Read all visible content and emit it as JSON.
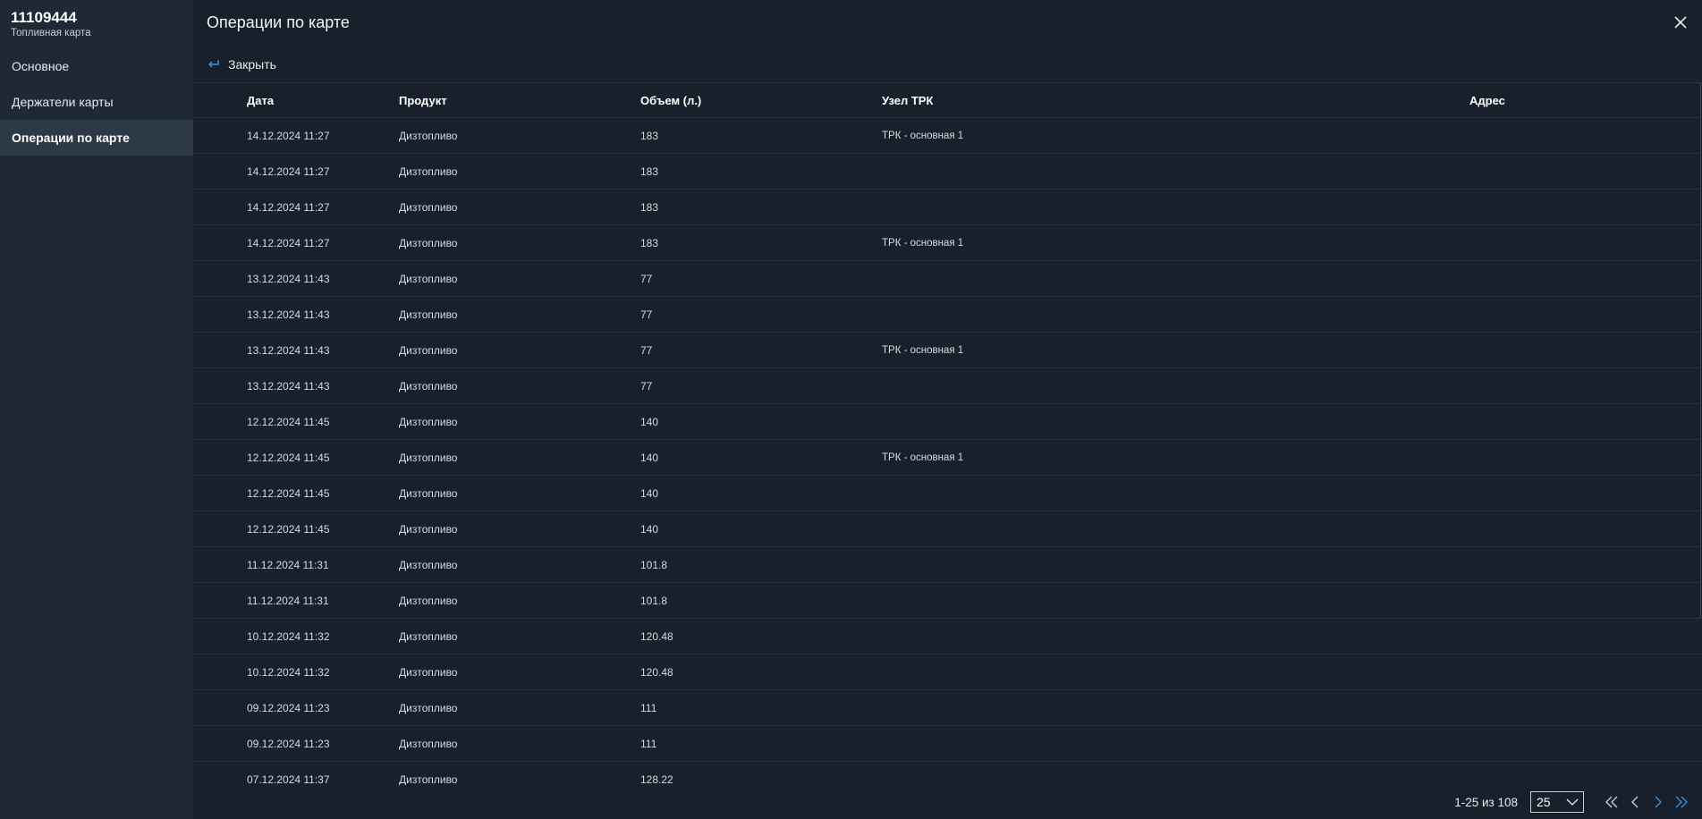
{
  "card": {
    "number": "11109444",
    "type": "Топливная карта"
  },
  "sidebar": {
    "items": [
      {
        "label": "Основное",
        "active": false
      },
      {
        "label": "Держатели карты",
        "active": false
      },
      {
        "label": "Операции по карте",
        "active": true
      }
    ]
  },
  "page": {
    "title": "Операции по карте",
    "close_label": "Закрыть"
  },
  "table": {
    "columns": [
      "Дата",
      "Продукт",
      "Объем (л.)",
      "Узел ТРК",
      "Адрес"
    ],
    "rows": [
      [
        "14.12.2024 11:27",
        "Дизтопливо",
        "183",
        "ТРК - основная 1",
        ""
      ],
      [
        "14.12.2024 11:27",
        "Дизтопливо",
        "183",
        "",
        ""
      ],
      [
        "14.12.2024 11:27",
        "Дизтопливо",
        "183",
        "",
        ""
      ],
      [
        "14.12.2024 11:27",
        "Дизтопливо",
        "183",
        "ТРК - основная 1",
        ""
      ],
      [
        "13.12.2024 11:43",
        "Дизтопливо",
        "77",
        "",
        ""
      ],
      [
        "13.12.2024 11:43",
        "Дизтопливо",
        "77",
        "",
        ""
      ],
      [
        "13.12.2024 11:43",
        "Дизтопливо",
        "77",
        "ТРК - основная 1",
        ""
      ],
      [
        "13.12.2024 11:43",
        "Дизтопливо",
        "77",
        "",
        ""
      ],
      [
        "12.12.2024 11:45",
        "Дизтопливо",
        "140",
        "",
        ""
      ],
      [
        "12.12.2024 11:45",
        "Дизтопливо",
        "140",
        "ТРК - основная 1",
        ""
      ],
      [
        "12.12.2024 11:45",
        "Дизтопливо",
        "140",
        "",
        ""
      ],
      [
        "12.12.2024 11:45",
        "Дизтопливо",
        "140",
        "",
        ""
      ],
      [
        "11.12.2024 11:31",
        "Дизтопливо",
        "101.8",
        "",
        ""
      ],
      [
        "11.12.2024 11:31",
        "Дизтопливо",
        "101.8",
        "",
        ""
      ],
      [
        "10.12.2024 11:32",
        "Дизтопливо",
        "120.48",
        "",
        ""
      ],
      [
        "10.12.2024 11:32",
        "Дизтопливо",
        "120.48",
        "",
        ""
      ],
      [
        "09.12.2024 11:23",
        "Дизтопливо",
        "111",
        "",
        ""
      ],
      [
        "09.12.2024 11:23",
        "Дизтопливо",
        "111",
        "",
        ""
      ],
      [
        "07.12.2024 11:37",
        "Дизтопливо",
        "128.22",
        "",
        ""
      ]
    ]
  },
  "footer": {
    "range": "1-25 из 108",
    "page_size": "25"
  },
  "colors": {
    "background": "#18202b",
    "sidebar": "#1f2935",
    "active_item": "#2c3947",
    "accent": "#3a8fd8"
  }
}
